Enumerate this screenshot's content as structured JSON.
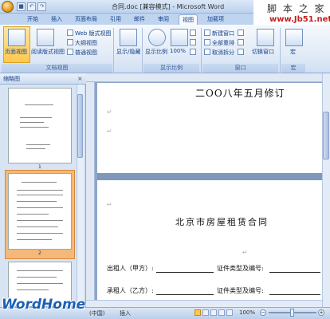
{
  "window": {
    "title": "合同.doc [兼容模式] - Microsoft Word"
  },
  "watermark": {
    "site_cn": "脚 本 之 家",
    "site_url": "www.Jb51.net",
    "brand": "WordHome"
  },
  "quick_access": {
    "icons": [
      "save-icon",
      "undo-icon",
      "redo-icon"
    ]
  },
  "tabs": [
    "开始",
    "插入",
    "页面布局",
    "引用",
    "邮件",
    "审阅",
    "视图",
    "加载项"
  ],
  "active_tab": "视图",
  "ribbon": {
    "group_doc_views": {
      "label": "文档视图",
      "page_view": "页面视图",
      "reading_view": "阅读版式视图",
      "web_view": "Web 版式视图",
      "outline": "大纲视图",
      "draft": "普通视图"
    },
    "group_show": {
      "label": "显示/隐藏"
    },
    "group_zoom": {
      "label": "显示比例",
      "zoom_btn": "显示比例",
      "percent": "100%"
    },
    "group_window": {
      "label": "窗口",
      "new_window": "新建窗口",
      "arrange_all": "全部重排",
      "split": "取消拆分",
      "switch_windows": "切换窗口"
    },
    "group_macro": {
      "label": "宏",
      "macro": "宏"
    }
  },
  "thumbnails": {
    "title": "缩略图",
    "close": "×",
    "pages": [
      "1",
      "2"
    ]
  },
  "document": {
    "revision_line": "二OO八年五月修订",
    "contract_title": "北京市房屋租赁合同",
    "lessor_label": "出租人（甲方）:",
    "lessee_label": "承租人（乙方）:",
    "id_type_label": "证件类型及编号:",
    "para_mark": "↵"
  },
  "statusbar": {
    "language": "(中国)",
    "insert": "插入",
    "zoom": "100%"
  },
  "colors": {
    "accent": "#15428b",
    "ribbon_bg": "#dfe9f6",
    "brand": "#1c5fb5"
  }
}
